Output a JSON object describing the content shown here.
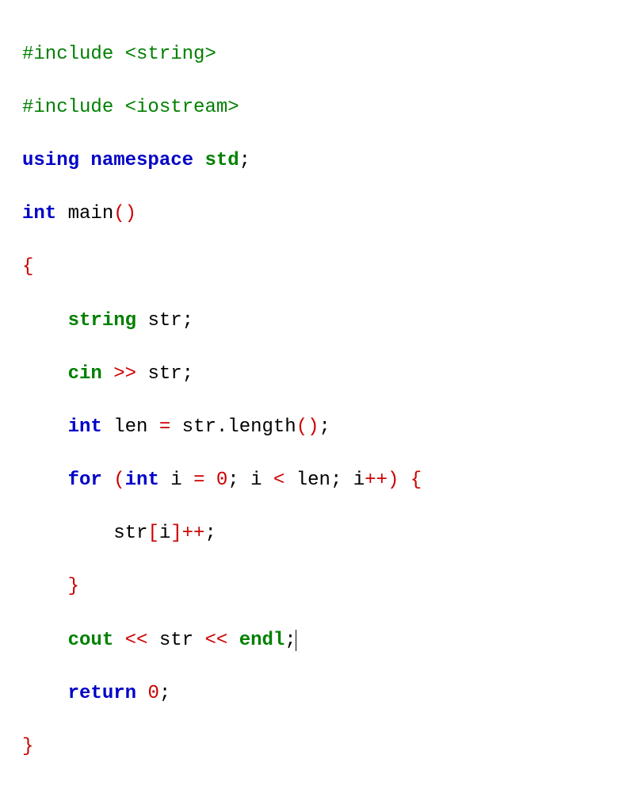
{
  "code": {
    "l1": {
      "pre": "#include",
      "angle": "<string>"
    },
    "l2": {
      "pre": "#include",
      "angle": "<iostream>"
    },
    "l3": {
      "kw1": "using",
      "kw2": "namespace",
      "ns": "std",
      "end": ";"
    },
    "l4": {
      "kw": "int",
      "name": "main",
      "parens": "()"
    },
    "l5": {
      "brace": "{"
    },
    "l6": {
      "type": "string",
      "var": "str",
      "end": ";"
    },
    "l7": {
      "obj": "cin",
      "op": ">>",
      "var": "str",
      "end": ";"
    },
    "l8": {
      "kw": "int",
      "var": "len",
      "eq": "=",
      "obj": "str",
      "dot": ".",
      "method": "length",
      "parens": "()",
      "end": ";"
    },
    "l9": {
      "kw": "for",
      "lp": "(",
      "kw2": "int",
      "var": "i",
      "eq": "=",
      "zero": "0",
      "semi1": ";",
      "var2": "i",
      "lt": "<",
      "len": "len",
      "semi2": ";",
      "var3": "i",
      "inc": "++",
      "rp": ")",
      "brace": "{"
    },
    "l10": {
      "var": "str",
      "lb": "[",
      "idx": "i",
      "rb": "]",
      "inc": "++",
      "end": ";"
    },
    "l11": {
      "brace": "}"
    },
    "l12": {
      "obj": "cout",
      "op1": "<<",
      "var": "str",
      "op2": "<<",
      "endl": "endl",
      "end": ";"
    },
    "l13": {
      "kw": "return",
      "val": "0",
      "end": ";"
    },
    "l14": {
      "brace": "}"
    }
  }
}
